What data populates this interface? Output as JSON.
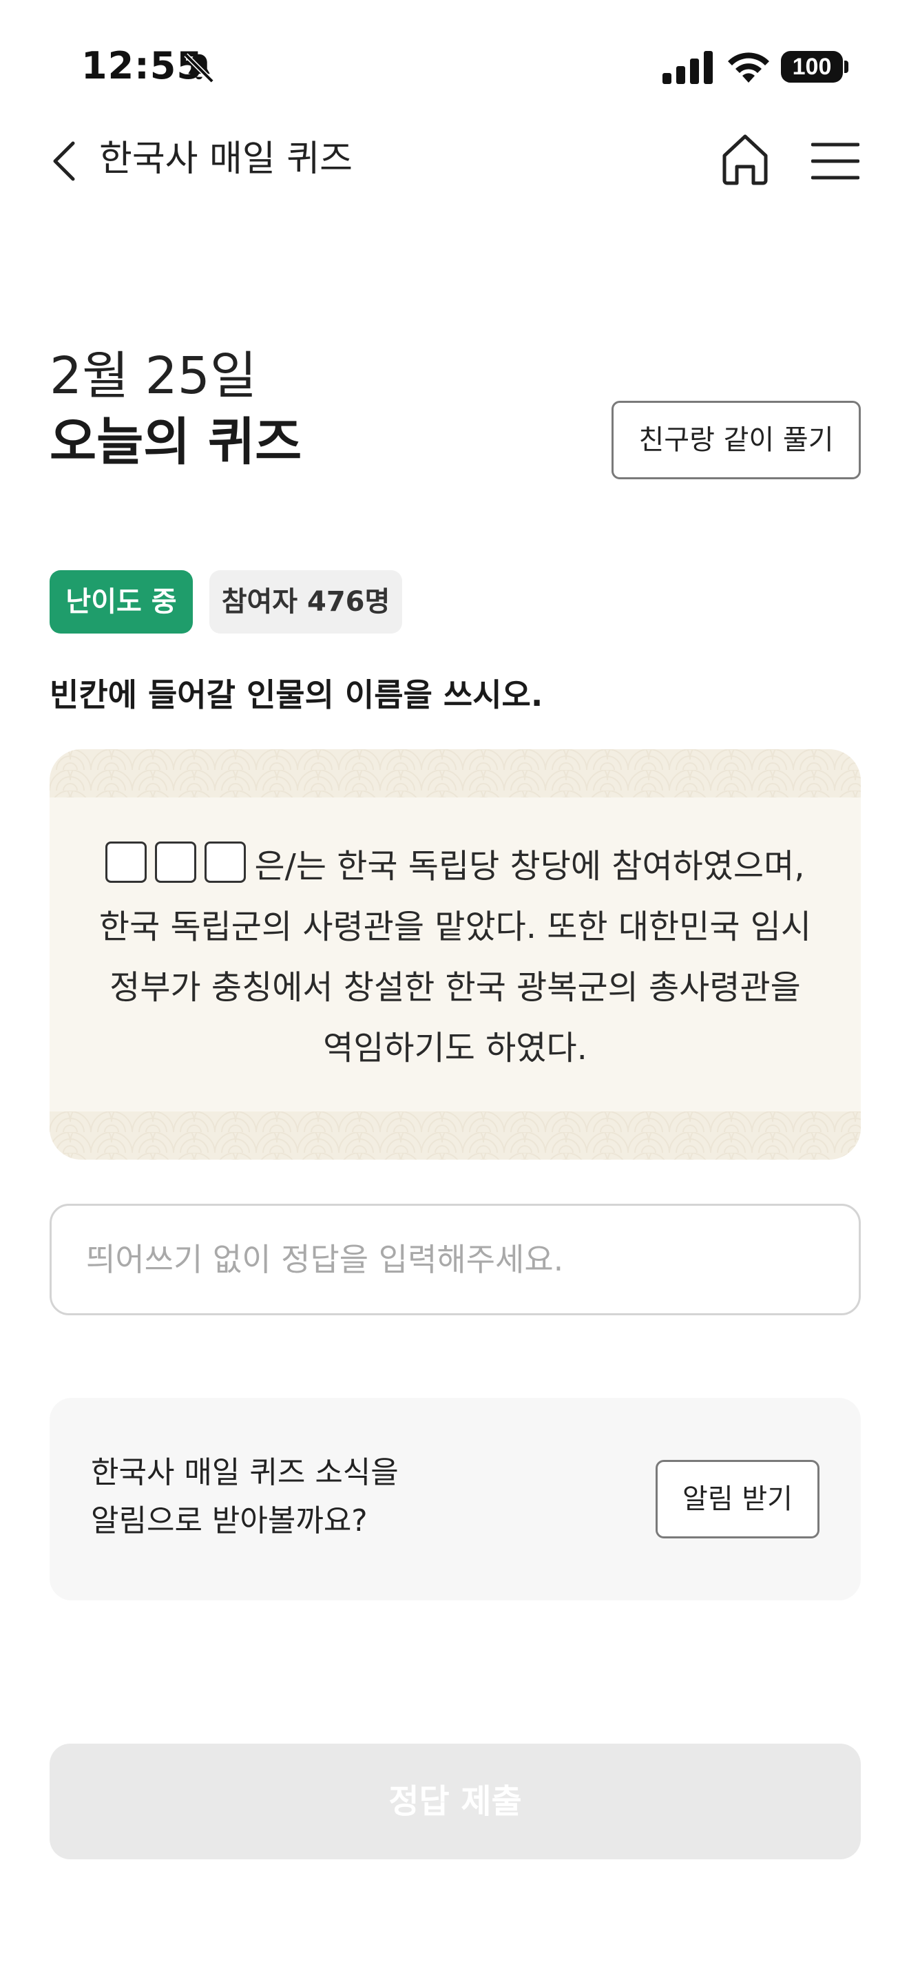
{
  "status_bar": {
    "time": "12:55",
    "battery": "100"
  },
  "nav": {
    "title": "한국사 매일 퀴즈"
  },
  "header": {
    "date": "2월 25일",
    "title": "오늘의 퀴즈",
    "friend_button": "친구랑 같이 풀기"
  },
  "badges": {
    "difficulty": "난이도 중",
    "participants": "참여자 476명"
  },
  "question": {
    "instruction": "빈칸에 들어갈 인물의 이름을 쓰시오.",
    "blank_count": 3,
    "text": "은/는 한국 독립당 창당에 참여하였으며, 한국 독립군의 사령관을 맡았다. 또한 대한민국 임시 정부가 충칭에서 창설한 한국 광복군의 총사령관을 역임하기도 하였다."
  },
  "answer": {
    "value": "",
    "placeholder": "띄어쓰기 없이 정답을 입력해주세요."
  },
  "notify": {
    "line1": "한국사 매일 퀴즈 소식을",
    "line2": "알림으로 받아볼까요?",
    "button": "알림 받기"
  },
  "submit": {
    "label": "정답 제출"
  },
  "colors": {
    "accent_green": "#1f9d6b",
    "card_bg": "#f9f6ef",
    "submit_disabled": "#e9e9e9"
  },
  "icons": [
    "bell-off-icon",
    "signal-icon",
    "wifi-icon",
    "battery-icon",
    "back-chevron-icon",
    "home-icon",
    "menu-icon"
  ]
}
